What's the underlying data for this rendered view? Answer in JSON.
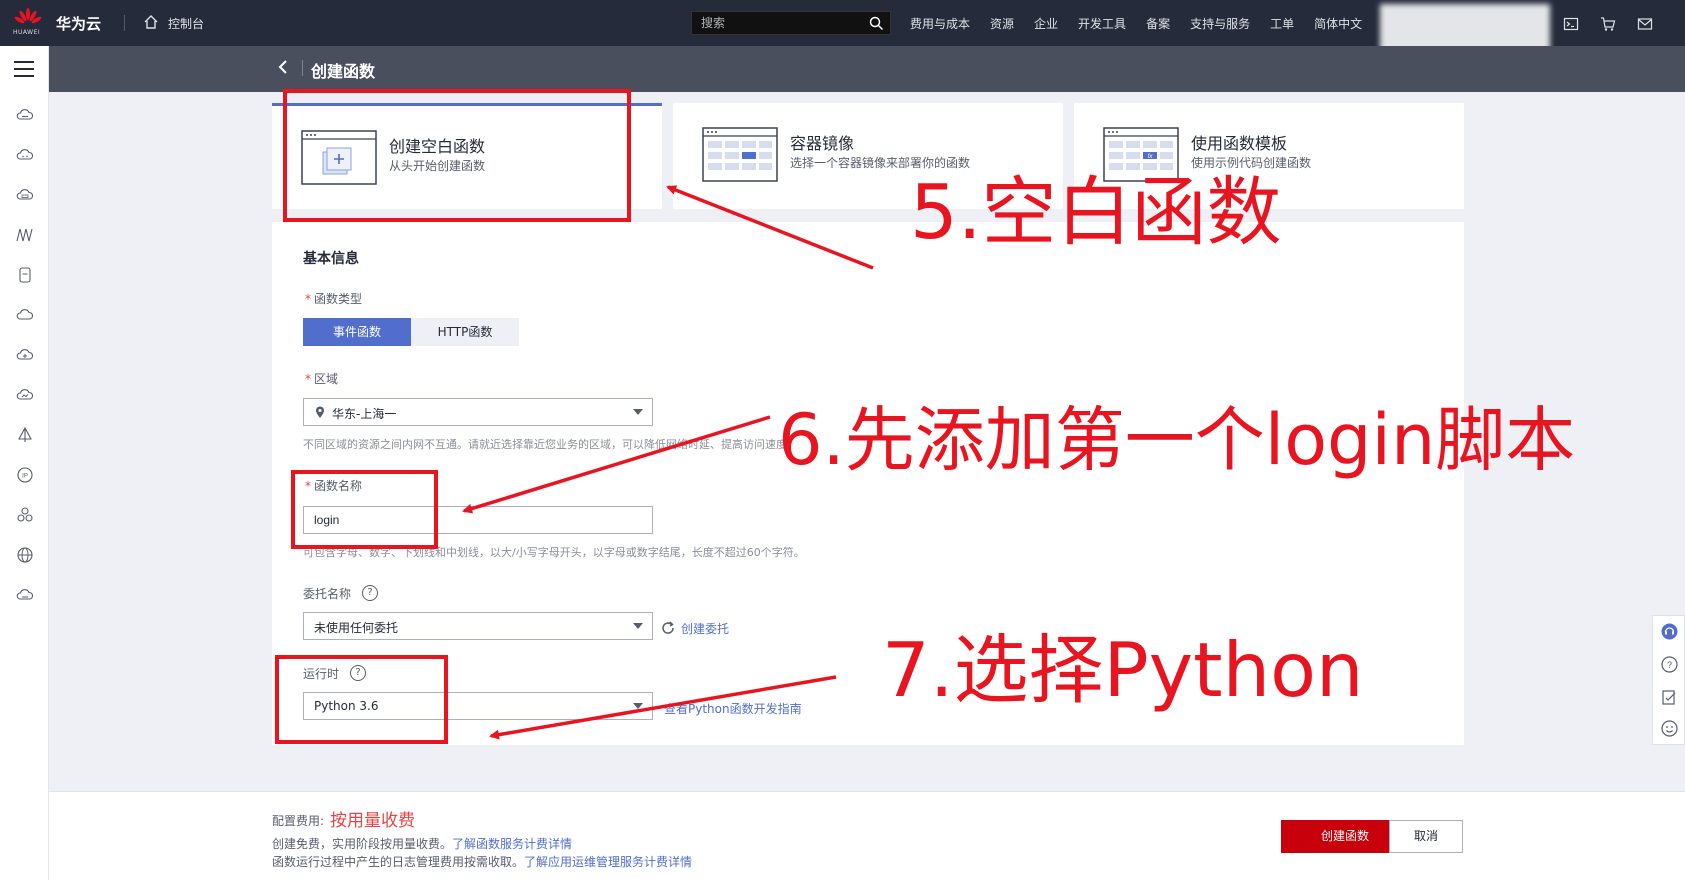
{
  "topbar": {
    "logo_text": "HUAWEI",
    "brand": "华为云",
    "console_label": "控制台",
    "search_placeholder": "搜索",
    "menu": [
      "费用与成本",
      "资源",
      "企业",
      "开发工具",
      "备案",
      "支持与服务",
      "工单",
      "简体中文"
    ],
    "icons": [
      "terminal-icon",
      "cart-icon",
      "mail-icon"
    ]
  },
  "sidebar": {
    "icons": [
      "cloud-icon",
      "cloud-icon",
      "cloud-icon",
      "waves-icon",
      "database-icon",
      "cloud-icon",
      "cloud-icon",
      "cloud-icon",
      "tree-icon",
      "ip-icon",
      "cluster-icon",
      "globe-icon",
      "cloud-icon"
    ]
  },
  "page": {
    "title": "创建函数"
  },
  "tabs": [
    {
      "title": "创建空白函数",
      "subtitle": "从头开始创建函数"
    },
    {
      "title": "容器镜像",
      "subtitle": "选择一个容器镜像来部署你的函数"
    },
    {
      "title": "使用函数模板",
      "subtitle": "使用示例代码创建函数"
    }
  ],
  "form": {
    "section_title": "基本信息",
    "function_type": {
      "label": "函数类型",
      "options": [
        "事件函数",
        "HTTP函数"
      ],
      "selected": "事件函数"
    },
    "region": {
      "label": "区域",
      "value": "华东-上海一",
      "hint": "不同区域的资源之间内网不互通。请就近选择靠近您业务的区域，可以降低网络时延、提高访问速度。"
    },
    "function_name": {
      "label": "函数名称",
      "value": "login",
      "hint": "可包含字母、数字、下划线和中划线，以大/小写字母开头，以字母或数字结尾，长度不超过60个字符。"
    },
    "agency": {
      "label": "委托名称",
      "value": "未使用任何委托",
      "link": "创建委托"
    },
    "runtime": {
      "label": "运行时",
      "value": "Python 3.6",
      "link": "查看Python函数开发指南"
    }
  },
  "footer": {
    "fee_label": "配置费用:",
    "fee_value": "按用量收费",
    "line1_text": "创建免费，实用阶段按用量收费。",
    "line1_link": "了解函数服务计费详情",
    "line2_text": "函数运行过程中产生的日志管理费用按需收取。",
    "line2_link": "了解应用运维管理服务计费详情",
    "create_button": "创建函数",
    "cancel_button": "取消"
  },
  "annotations": {
    "step5": "5.空白函数",
    "step6": "6.先添加第一个login脚本",
    "step7": "7.选择Python",
    "color": "#e8141f"
  },
  "colors": {
    "accent": "#526ecc",
    "brand_red": "#c7000b",
    "topbar": "#252b3a",
    "subheader": "#4a4f5e"
  }
}
